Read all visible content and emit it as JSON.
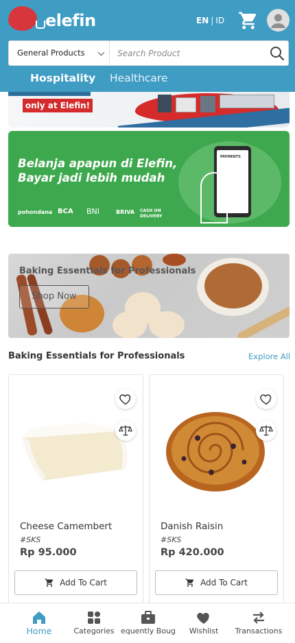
{
  "header": {
    "logo_text": "elefin",
    "lang_en": "EN",
    "lang_sep": "|",
    "lang_id": "ID",
    "brand_color": "#3f9cc3",
    "logo_color": "#d8363d"
  },
  "search": {
    "category": "General Products",
    "placeholder": "Search Product"
  },
  "tabs": [
    {
      "label": "Hospitality",
      "active": true
    },
    {
      "label": "Healthcare",
      "active": false
    }
  ],
  "banners": {
    "top_badge": "only at Elefin!",
    "payment_line1": "Belanja apapun di Elefin,",
    "payment_line2": "Bayar jadi lebih mudah",
    "payment_methods": [
      "pohondana",
      "BCA",
      "BNI",
      "BRIVA",
      "CASH ON DELIVERY"
    ],
    "phone_screen_title": "PAYMENTS",
    "promo_title": "Baking Essentials for Professionals",
    "promo_button": "Shop Now"
  },
  "section": {
    "title": "Baking Essentials for Professionals",
    "explore": "Explore All"
  },
  "products": [
    {
      "name": "Cheese Camembert",
      "tag": "#SKS",
      "price": "Rp 95.000",
      "button": "Add To Cart"
    },
    {
      "name": "Danish Raisin",
      "tag": "#SKS",
      "price": "Rp 420.000",
      "button": "Add To Cart"
    }
  ],
  "bottom_nav": [
    {
      "label": "Home",
      "icon": "home-icon",
      "active": true
    },
    {
      "label": "Categories",
      "icon": "categories-icon",
      "active": false
    },
    {
      "label": "equently Boug",
      "icon": "briefcase-icon",
      "active": false
    },
    {
      "label": "Wishlist",
      "icon": "heart-icon",
      "active": false
    },
    {
      "label": "Transactions",
      "icon": "transfer-icon",
      "active": false
    }
  ]
}
